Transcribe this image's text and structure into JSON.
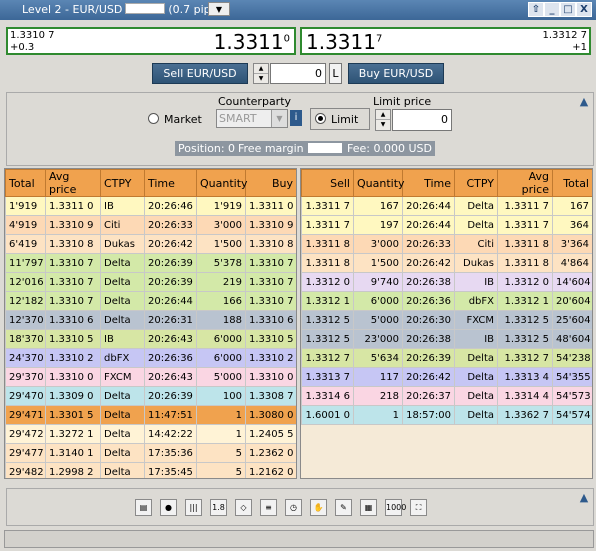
{
  "window": {
    "title": "Level 2 - EUR/USD",
    "spread": "(0.7 pips)",
    "buttons": [
      "⇧",
      "_",
      "□",
      "X"
    ]
  },
  "sell_quote": {
    "small_price": "1.3310 7",
    "change": "+0.3",
    "big_price": "1.3311",
    "big_sup": "0"
  },
  "buy_quote": {
    "big_price": "1.3311",
    "big_sup": "7",
    "small_price": "1.3312 7",
    "change": "+1"
  },
  "order_bar": {
    "sell_label": "Sell EUR/USD",
    "qty_value": "0",
    "qty_unit": "L",
    "buy_label": "Buy EUR/USD"
  },
  "order_panel": {
    "market_label": "Market",
    "counterparty_label": "Counterparty",
    "counterparty_value": "SMART",
    "limit_label": "Limit",
    "limit_price_label": "Limit price",
    "limit_price_value": "0",
    "position": "Position: 0",
    "free_margin": "Free margin",
    "fee": "Fee: 0.000 USD"
  },
  "buy_table": {
    "headers": [
      "Total",
      "Avg price",
      "CTPY",
      "Time",
      "Quantity",
      "Buy"
    ],
    "rows": [
      {
        "c": [
          "1'919",
          "1.3311 0",
          "IB",
          "20:26:46",
          "1'919",
          "1.3311 0"
        ],
        "bg": "#fff8c0"
      },
      {
        "c": [
          "4'919",
          "1.3310 9",
          "Citi",
          "20:26:33",
          "3'000",
          "1.3310 9"
        ],
        "bg": "#fdd9b5"
      },
      {
        "c": [
          "6'419",
          "1.3310 8",
          "Dukas",
          "20:26:42",
          "1'500",
          "1.3310 8"
        ],
        "bg": "#fde3c3"
      },
      {
        "c": [
          "11'797",
          "1.3310 7",
          "Delta",
          "20:26:39",
          "5'378",
          "1.3310 7"
        ],
        "bg": "#d3e9a8"
      },
      {
        "c": [
          "12'016",
          "1.3310 7",
          "Delta",
          "20:26:39",
          "219",
          "1.3310 7"
        ],
        "bg": "#d3e9a8"
      },
      {
        "c": [
          "12'182",
          "1.3310 7",
          "Delta",
          "20:26:44",
          "166",
          "1.3310 7"
        ],
        "bg": "#d3e9a8"
      },
      {
        "c": [
          "12'370",
          "1.3310 6",
          "Delta",
          "20:26:31",
          "188",
          "1.3310 6"
        ],
        "bg": "#b9c3d0"
      },
      {
        "c": [
          "18'370",
          "1.3310 5",
          "IB",
          "20:26:43",
          "6'000",
          "1.3310 5"
        ],
        "bg": "#d7e6a4"
      },
      {
        "c": [
          "24'370",
          "1.3310 2",
          "dbFX",
          "20:26:36",
          "6'000",
          "1.3310 2"
        ],
        "bg": "#c6c6f4"
      },
      {
        "c": [
          "29'370",
          "1.3310 0",
          "FXCM",
          "20:26:43",
          "5'000",
          "1.3310 0"
        ],
        "bg": "#fad6e3"
      },
      {
        "c": [
          "29'470",
          "1.3309 0",
          "Delta",
          "20:26:39",
          "100",
          "1.3308 7"
        ],
        "bg": "#bde4ea"
      },
      {
        "c": [
          "29'471",
          "1.3301 5",
          "Delta",
          "11:47:51",
          "1",
          "1.3080 0"
        ],
        "bg": "#f0a24e"
      },
      {
        "c": [
          "29'472",
          "1.3272 1",
          "Delta",
          "14:42:22",
          "1",
          "1.2405 5"
        ],
        "bg": "#fff3d6"
      },
      {
        "c": [
          "29'477",
          "1.3140 1",
          "Delta",
          "17:35:36",
          "5",
          "1.2362 0"
        ],
        "bg": "#fde3c3"
      },
      {
        "c": [
          "29'482",
          "1.2998 2",
          "Delta",
          "17:35:45",
          "5",
          "1.2162 0"
        ],
        "bg": "#fde3c3"
      }
    ]
  },
  "sell_table": {
    "headers": [
      "Sell",
      "Quantity",
      "Time",
      "CTPY",
      "Avg price",
      "Total"
    ],
    "rows": [
      {
        "c": [
          "1.3311 7",
          "167",
          "20:26:44",
          "Delta",
          "1.3311 7",
          "167"
        ],
        "bg": "#fff8c0"
      },
      {
        "c": [
          "1.3311 7",
          "197",
          "20:26:44",
          "Delta",
          "1.3311 7",
          "364"
        ],
        "bg": "#fff8c0"
      },
      {
        "c": [
          "1.3311 8",
          "3'000",
          "20:26:33",
          "Citi",
          "1.3311 8",
          "3'364"
        ],
        "bg": "#fdd9b5"
      },
      {
        "c": [
          "1.3311 8",
          "1'500",
          "20:26:42",
          "Dukas",
          "1.3311 8",
          "4'864"
        ],
        "bg": "#fde3c3"
      },
      {
        "c": [
          "1.3312 0",
          "9'740",
          "20:26:38",
          "IB",
          "1.3312 0",
          "14'604"
        ],
        "bg": "#e7d9f2"
      },
      {
        "c": [
          "1.3312 1",
          "6'000",
          "20:26:36",
          "dbFX",
          "1.3312 1",
          "20'604"
        ],
        "bg": "#d3e9a8"
      },
      {
        "c": [
          "1.3312 5",
          "5'000",
          "20:26:30",
          "FXCM",
          "1.3312 5",
          "25'604"
        ],
        "bg": "#b9c3d0"
      },
      {
        "c": [
          "1.3312 5",
          "23'000",
          "20:26:38",
          "IB",
          "1.3312 5",
          "48'604"
        ],
        "bg": "#b9c3d0"
      },
      {
        "c": [
          "1.3312 7",
          "5'634",
          "20:26:39",
          "Delta",
          "1.3312 7",
          "54'238"
        ],
        "bg": "#d7e6a4"
      },
      {
        "c": [
          "1.3313 7",
          "117",
          "20:26:42",
          "Delta",
          "1.3313 4",
          "54'355"
        ],
        "bg": "#c6c6f4"
      },
      {
        "c": [
          "1.3314 6",
          "218",
          "20:26:37",
          "Delta",
          "1.3314 4",
          "54'573"
        ],
        "bg": "#fad6e3"
      },
      {
        "c": [
          "1.6001 0",
          "1",
          "18:57:00",
          "Delta",
          "1.3362 7",
          "54'574"
        ],
        "bg": "#bde4ea"
      }
    ]
  },
  "toolbar": {
    "icons": [
      "sheet-icon",
      "coins-icon",
      "candles-icon",
      "chip-icon",
      "network-icon",
      "stack-icon",
      "clock-icon",
      "hand-icon",
      "note-icon",
      "picture-icon",
      "counter-icon",
      "fullscreen-icon"
    ],
    "glyphs": [
      "▤",
      "●",
      "|||",
      "1.8",
      "◇",
      "≡",
      "◷",
      "✋",
      "✎",
      "▦",
      "1000",
      "⛶"
    ]
  }
}
